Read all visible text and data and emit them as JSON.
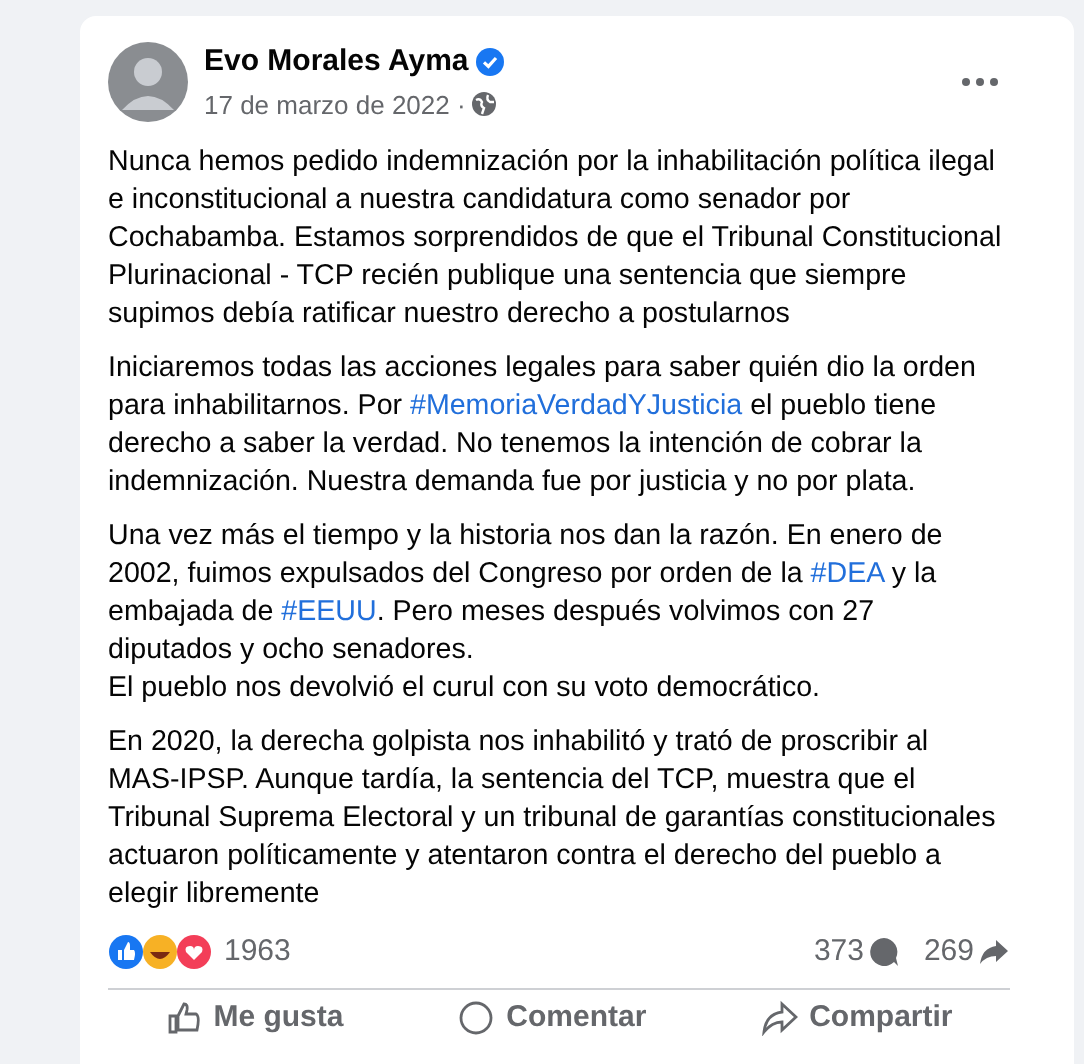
{
  "post": {
    "author": "Evo Morales Ayma",
    "verified": true,
    "date": "17 de marzo de 2022 · ",
    "paragraphs": [
      [
        [
          {
            "kind": "text",
            "text": "Nunca hemos pedido indemnización por la inhabilitación política ilegal e inconstitucional a nuestra candidatura como senador por Cochabamba. Estamos sorprendidos de que el Tribunal Constitucional Plurinacional - TCP recién publique una sentencia que siempre supimos debía ratificar nuestro derecho a postularnos"
          }
        ]
      ],
      [
        [
          {
            "kind": "text",
            "text": "Iniciaremos todas las acciones legales para saber quién dio la orden para inhabilitarnos. Por "
          },
          {
            "kind": "hashtag",
            "text": "#MemoriaVerdadYJusticia"
          },
          {
            "kind": "text",
            "text": " el pueblo tiene derecho a saber la verdad. No tenemos la intención de cobrar la indemnización. Nuestra demanda fue por justicia y no por plata."
          }
        ]
      ],
      [
        [
          {
            "kind": "text",
            "text": "Una vez más el tiempo y la historia nos dan la razón. En enero de 2002, fuimos expulsados del Congreso por orden de la "
          },
          {
            "kind": "hashtag",
            "text": "#DEA"
          },
          {
            "kind": "text",
            "text": " y la embajada de "
          },
          {
            "kind": "hashtag",
            "text": "#EEUU"
          },
          {
            "kind": "text",
            "text": ". Pero meses después volvimos con 27 diputados y ocho senadores."
          }
        ],
        [
          {
            "kind": "text",
            "text": "El pueblo nos devolvió el curul con su voto democrático."
          }
        ]
      ],
      [
        [
          {
            "kind": "text",
            "text": "En 2020, la derecha golpista nos inhabilitó y trató de proscribir al MAS-IPSP. Aunque tardía, la sentencia del TCP, muestra que el Tribunal Suprema Electoral y un tribunal de garantías constitucionales actuaron políticamente y atentaron contra el derecho del pueblo a elegir libremente"
          }
        ]
      ]
    ],
    "reactions_count": "1963",
    "comments_count": "373",
    "shares_count": "269",
    "actions": [
      "Me gusta",
      "Comentar",
      "Compartir"
    ]
  }
}
